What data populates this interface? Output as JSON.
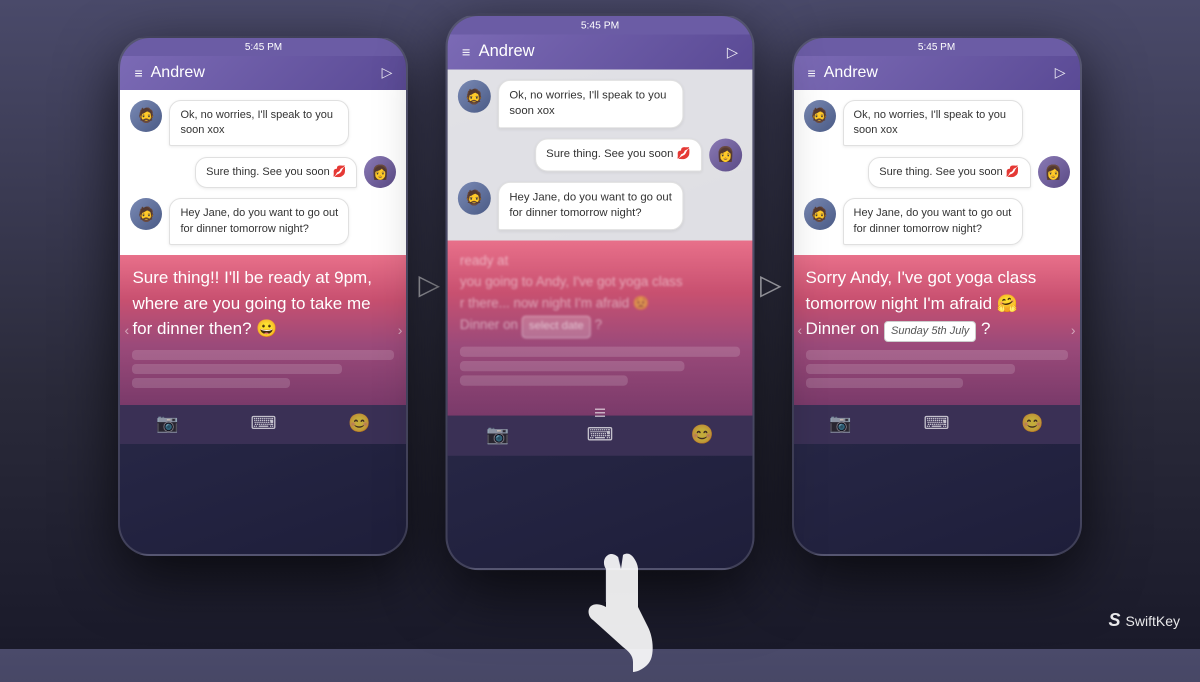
{
  "background": {
    "color_top": "#4a4a6a",
    "color_bottom": "#1a1a2a"
  },
  "phones": [
    {
      "id": "phone-left",
      "status_bar": {
        "time": "5:45 PM"
      },
      "header": {
        "menu_label": "≡",
        "contact_name": "Andrew",
        "send_icon": "▷"
      },
      "messages": [
        {
          "type": "received",
          "avatar": "👤",
          "text": "Ok, no worries, I'll speak to you soon xox"
        },
        {
          "type": "sent",
          "avatar": "👩",
          "text": "Sure thing. See you soon 💋"
        },
        {
          "type": "received",
          "avatar": "👤",
          "text": "Hey Jane, do you want to go out for dinner tomorrow night?"
        }
      ],
      "keyboard_area": {
        "main_text": "Sure thing!! I'll be ready at 9pm, where are you going to take me for dinner then? 😀",
        "style": "pink-gradient",
        "suggestion_bars": 3
      },
      "toolbar": {
        "icons": [
          "📷",
          "⌨",
          "😊"
        ]
      }
    },
    {
      "id": "phone-middle",
      "status_bar": {
        "time": "5:45 PM"
      },
      "header": {
        "menu_label": "≡",
        "contact_name": "Andrew",
        "send_icon": "▷"
      },
      "messages": [
        {
          "type": "received",
          "avatar": "👤",
          "text": "Ok, no worries, I'll speak to you soon xox"
        },
        {
          "type": "sent",
          "avatar": "👩",
          "text": "Sure thing. See you soon 💋"
        },
        {
          "type": "received",
          "avatar": "👤",
          "text": "Hey Jane, do you want to go out for dinner tomorrow night?"
        }
      ],
      "keyboard_area": {
        "blurred_lines": [
          "ready at",
          "you going to Andy, I've got yoga class",
          "r there...... now night I'm afraid 😟",
          "Dinner on [select date] ?"
        ],
        "style": "pink-gradient-blurred",
        "suggestion_bars": 3
      },
      "toolbar": {
        "icons": [
          "📷",
          "⌨",
          "😊"
        ]
      },
      "has_overlay": true,
      "has_hand": true
    },
    {
      "id": "phone-right",
      "status_bar": {
        "time": "5:45 PM"
      },
      "header": {
        "menu_label": "≡",
        "contact_name": "Andrew",
        "send_icon": "▷"
      },
      "messages": [
        {
          "type": "received",
          "avatar": "👤",
          "text": "Ok, no worries, I'll speak to you soon xox"
        },
        {
          "type": "sent",
          "avatar": "👩",
          "text": "Sure thing. See you soon 💋"
        },
        {
          "type": "received",
          "avatar": "👤",
          "text": "Hey Jane, do you want to go out for dinner tomorrow night?"
        }
      ],
      "keyboard_area": {
        "main_text": "Sorry Andy, I've got yoga class tomorrow night I'm afraid 🤗 Dinner on",
        "date_value": "Sunday 5th July",
        "date_placeholder": "select date",
        "after_date": "?",
        "style": "pink-gradient",
        "suggestion_bars": 3
      },
      "toolbar": {
        "icons": [
          "📷",
          "⌨",
          "😊"
        ]
      }
    }
  ],
  "arrows": {
    "between_symbol": "▷"
  },
  "branding": {
    "logo_symbol": "S",
    "logo_name": "SwiftKey"
  }
}
